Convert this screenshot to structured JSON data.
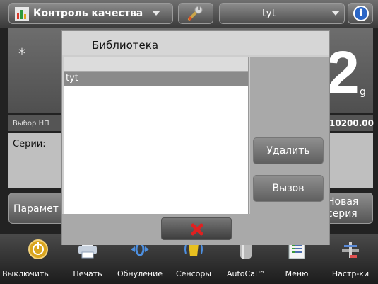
{
  "header": {
    "app_title": "Контроль качества",
    "library_value": "tyt"
  },
  "weighing": {
    "star": "*",
    "value": "2",
    "unit": "g"
  },
  "info": {
    "np_label": "Выбор НП",
    "np_value": "10200.00"
  },
  "series": {
    "label": "Серии:"
  },
  "buttons": {
    "params": "Парамет",
    "new_series_line1": "Новая",
    "new_series_line2": "серия"
  },
  "modal": {
    "title": "Библиотека",
    "items": [
      "tyt"
    ],
    "delete_label": "Удалить",
    "recall_label": "Вызов"
  },
  "toolbar": {
    "items": [
      {
        "label": "Выключить",
        "icon": "power-icon"
      },
      {
        "label": "Печать",
        "icon": "printer-icon"
      },
      {
        "label": "Обнуление",
        "icon": "zero-icon"
      },
      {
        "label": "Сенсоры",
        "icon": "sensors-icon"
      },
      {
        "label": "AutoCal™",
        "icon": "autocal-icon"
      },
      {
        "label": "Меню",
        "icon": "menu-icon"
      },
      {
        "label": "Настр-ки",
        "icon": "settings-icon"
      }
    ]
  },
  "colors": {
    "accent_blue": "#2b66c6",
    "close_red": "#e02020",
    "selected_row": "#8a8a8a"
  }
}
